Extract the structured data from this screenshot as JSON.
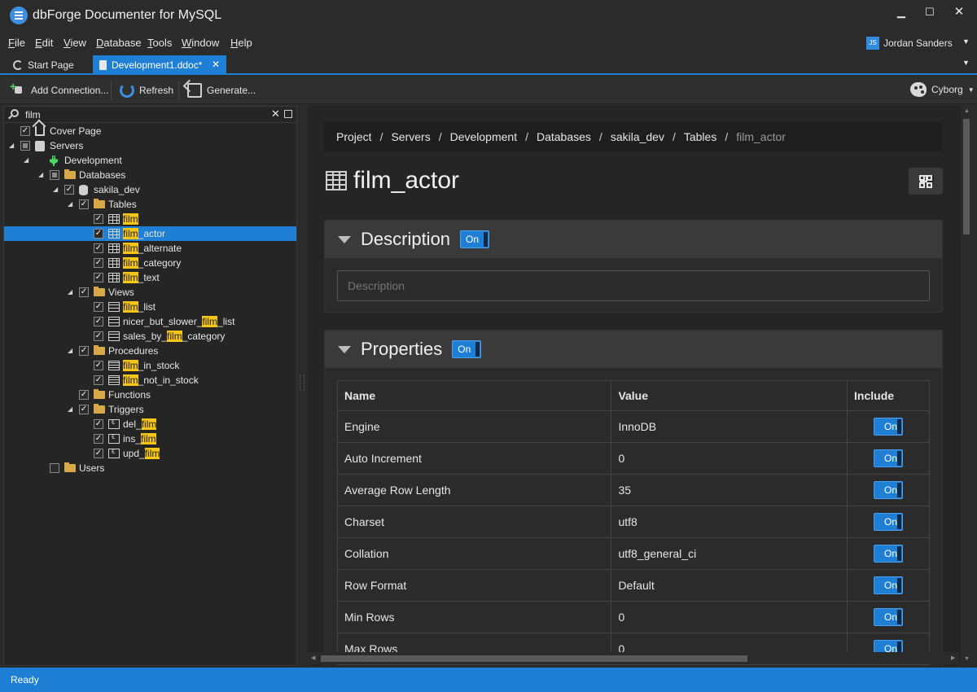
{
  "app": {
    "title": "dbForge Documenter for MySQL",
    "window_controls": {
      "minimize": "▁",
      "maximize": "☐",
      "close": "✕"
    }
  },
  "menu": [
    {
      "label": "File",
      "u": "F",
      "rest": "ile"
    },
    {
      "label": "Edit",
      "u": "E",
      "rest": "dit"
    },
    {
      "label": "View",
      "u": "V",
      "rest": "iew"
    },
    {
      "label": "Database",
      "u": "D",
      "rest": "atabase"
    },
    {
      "label": "Tools",
      "u": "T",
      "rest": "ools"
    },
    {
      "label": "Window",
      "u": "W",
      "rest": "indow"
    },
    {
      "label": "Help",
      "u": "H",
      "rest": "elp"
    }
  ],
  "user": {
    "initials": "JS",
    "name": "Jordan Sanders"
  },
  "tabs": {
    "start": "Start Page",
    "active": "Development1.ddoc*"
  },
  "toolbar": {
    "add_connection": "Add Connection...",
    "refresh": "Refresh",
    "generate": "Generate...",
    "theme": "Cyborg"
  },
  "tree": {
    "search_value": "film",
    "nodes": [
      {
        "label": "Cover Page",
        "pre": "",
        "hit": "",
        "post": "Cover Page",
        "icon": "home"
      },
      {
        "label": "Servers",
        "pre": "",
        "hit": "",
        "post": "Servers",
        "icon": "servers"
      },
      {
        "label": "Development",
        "pre": "",
        "hit": "",
        "post": "Development",
        "icon": "connection"
      },
      {
        "label": "Databases",
        "pre": "",
        "hit": "",
        "post": "Databases",
        "icon": "folder"
      },
      {
        "label": "sakila_dev",
        "pre": "",
        "hit": "",
        "post": "sakila_dev",
        "icon": "database"
      },
      {
        "label": "Tables",
        "pre": "",
        "hit": "",
        "post": "Tables",
        "icon": "folder"
      },
      {
        "label": "film",
        "pre": "",
        "hit": "film",
        "post": "",
        "icon": "table"
      },
      {
        "label": "film_actor",
        "pre": "",
        "hit": "film",
        "post": "_actor",
        "icon": "table"
      },
      {
        "label": "film_alternate",
        "pre": "",
        "hit": "film",
        "post": "_alternate",
        "icon": "table"
      },
      {
        "label": "film_category",
        "pre": "",
        "hit": "film",
        "post": "_category",
        "icon": "table"
      },
      {
        "label": "film_text",
        "pre": "",
        "hit": "film",
        "post": "_text",
        "icon": "table"
      },
      {
        "label": "Views",
        "pre": "",
        "hit": "",
        "post": "Views",
        "icon": "folder"
      },
      {
        "label": "film_list",
        "pre": "",
        "hit": "film",
        "post": "_list",
        "icon": "view"
      },
      {
        "label": "nicer_but_slower_film_list",
        "pre": "nicer_but_slower_",
        "hit": "film",
        "post": "_list",
        "icon": "view"
      },
      {
        "label": "sales_by_film_category",
        "pre": "sales_by_",
        "hit": "film",
        "post": "_category",
        "icon": "view"
      },
      {
        "label": "Procedures",
        "pre": "",
        "hit": "",
        "post": "Procedures",
        "icon": "folder"
      },
      {
        "label": "film_in_stock",
        "pre": "",
        "hit": "film",
        "post": "_in_stock",
        "icon": "procedure"
      },
      {
        "label": "film_not_in_stock",
        "pre": "",
        "hit": "film",
        "post": "_not_in_stock",
        "icon": "procedure"
      },
      {
        "label": "Functions",
        "pre": "",
        "hit": "",
        "post": "Functions",
        "icon": "folder"
      },
      {
        "label": "Triggers",
        "pre": "",
        "hit": "",
        "post": "Triggers",
        "icon": "folder"
      },
      {
        "label": "del_film",
        "pre": "del_",
        "hit": "film",
        "post": "",
        "icon": "trigger"
      },
      {
        "label": "ins_film",
        "pre": "ins_",
        "hit": "film",
        "post": "",
        "icon": "trigger"
      },
      {
        "label": "upd_film",
        "pre": "upd_",
        "hit": "film",
        "post": "",
        "icon": "trigger"
      },
      {
        "label": "Users",
        "pre": "",
        "hit": "",
        "post": "Users",
        "icon": "folder"
      }
    ],
    "check_mark": "✓"
  },
  "breadcrumb": {
    "items": [
      "Project",
      "Servers",
      "Development",
      "Databases",
      "sakila_dev",
      "Tables"
    ],
    "separator": "/",
    "current": "film_actor"
  },
  "page": {
    "title": "film_actor"
  },
  "description_section": {
    "title": "Description",
    "toggle": "On",
    "placeholder": "Description"
  },
  "properties_section": {
    "title": "Properties",
    "toggle": "On",
    "columns": [
      "Name",
      "Value",
      "Include"
    ],
    "rows": [
      {
        "name": "Engine",
        "value": "InnoDB",
        "include": "On"
      },
      {
        "name": "Auto Increment",
        "value": "0",
        "include": "On"
      },
      {
        "name": "Average Row Length",
        "value": "35",
        "include": "On"
      },
      {
        "name": "Charset",
        "value": "utf8",
        "include": "On"
      },
      {
        "name": "Collation",
        "value": "utf8_general_ci",
        "include": "On"
      },
      {
        "name": "Row Format",
        "value": "Default",
        "include": "On"
      },
      {
        "name": "Min Rows",
        "value": "0",
        "include": "On"
      },
      {
        "name": "Max Rows",
        "value": "0",
        "include": "On"
      }
    ]
  },
  "status": {
    "text": "Ready"
  },
  "colors": {
    "accent": "#1f7fd4",
    "highlight": "#f5c518",
    "background": "#252526"
  }
}
